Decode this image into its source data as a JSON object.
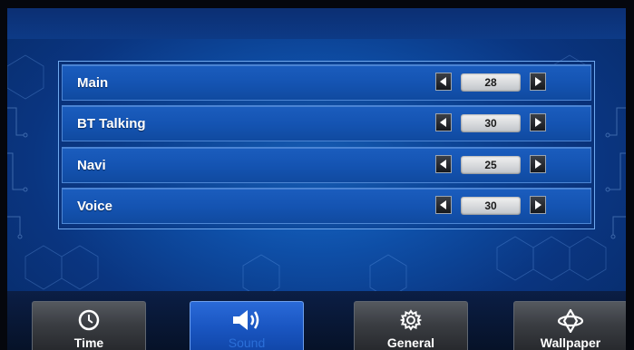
{
  "settings": {
    "rows": [
      {
        "label": "Main",
        "value": "28"
      },
      {
        "label": "BT Talking",
        "value": "30"
      },
      {
        "label": "Navi",
        "value": "25"
      },
      {
        "label": "Voice",
        "value": "30"
      }
    ]
  },
  "tabs": [
    {
      "label": "Time",
      "icon": "clock-icon",
      "active": false
    },
    {
      "label": "Sound",
      "icon": "speaker-icon",
      "active": true
    },
    {
      "label": "General",
      "icon": "gear-icon",
      "active": false
    },
    {
      "label": "Wallpaper",
      "icon": "diamond-icon",
      "active": false
    }
  ],
  "colors": {
    "background": "#0e4ea6",
    "row": "#1453b1",
    "active_tab": "#1a56c2",
    "inactive_tab": "#3a3d42"
  }
}
